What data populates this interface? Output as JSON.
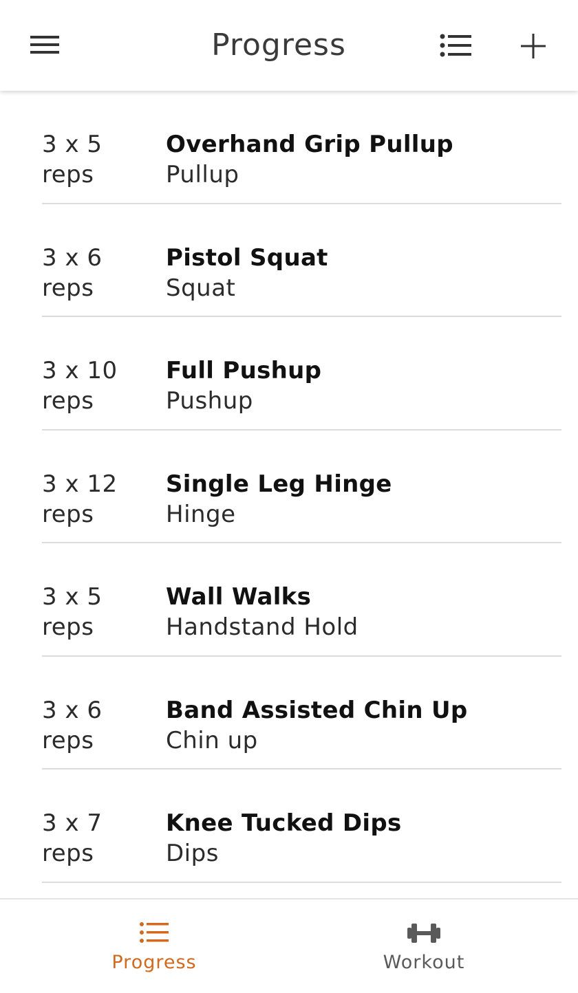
{
  "app_bar": {
    "title": "Progress",
    "menu_icon": "hamburger-menu-icon",
    "list_icon": "list-icon",
    "add_icon": "plus-icon"
  },
  "exercises": [
    {
      "sets": "3 x 5",
      "unit": "reps",
      "name": "Overhand Grip Pullup",
      "category": "Pullup"
    },
    {
      "sets": "3 x 6",
      "unit": "reps",
      "name": "Pistol Squat",
      "category": "Squat"
    },
    {
      "sets": "3 x 10",
      "unit": "reps",
      "name": "Full Pushup",
      "category": "Pushup"
    },
    {
      "sets": "3 x 12",
      "unit": "reps",
      "name": "Single Leg Hinge",
      "category": "Hinge"
    },
    {
      "sets": "3 x 5",
      "unit": "reps",
      "name": "Wall Walks",
      "category": "Handstand Hold"
    },
    {
      "sets": "3 x 6",
      "unit": "reps",
      "name": "Band Assisted Chin Up",
      "category": "Chin up"
    },
    {
      "sets": "3 x 7",
      "unit": "reps",
      "name": "Knee Tucked Dips",
      "category": "Dips"
    }
  ],
  "bottom_nav": {
    "items": [
      {
        "label": "Progress",
        "icon": "list-icon",
        "active": true
      },
      {
        "label": "Workout",
        "icon": "dumbbell-icon",
        "active": false
      }
    ]
  },
  "colors": {
    "accent": "#D2691E",
    "inactive": "#5a5a5a",
    "divider": "#dcdcdc"
  }
}
